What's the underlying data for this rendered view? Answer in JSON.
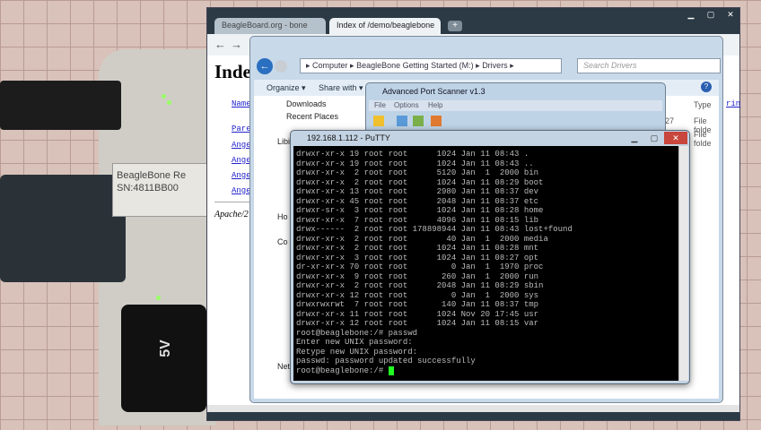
{
  "photo": {
    "board_label": "BeagleBone Re",
    "serial": "SN:4811BB00",
    "power_label": "5V"
  },
  "browser": {
    "tabs": [
      {
        "label": "BeagleBoard.org - bone"
      },
      {
        "label": "Index of /demo/beaglebone"
      }
    ],
    "new_tab": "+",
    "heading": "Inde",
    "name_header": "Name",
    "links": [
      "Pare",
      "Ange",
      "Ange",
      "Ange",
      "Ange"
    ],
    "footer": "Apache/2",
    "right_link": "rin"
  },
  "explorer": {
    "breadcrumb": [
      "Computer",
      "BeagleBone Getting Started (M:)",
      "Drivers"
    ],
    "search_placeholder": "Search Drivers",
    "commands": [
      "Organize ▾",
      "Share with ▾"
    ],
    "nav": [
      "Downloads",
      "Recent Places",
      "Libi",
      "Ho",
      "Co",
      "Net"
    ],
    "type_header": "Type",
    "rows": [
      {
        "date": "27",
        "type": "File folde"
      },
      {
        "date": "",
        "type": "File folde"
      }
    ]
  },
  "scanner": {
    "title": "Advanced Port Scanner v1.3",
    "menu": [
      "File",
      "Options",
      "Help"
    ]
  },
  "putty": {
    "title": "192.168.1.112 - PuTTY",
    "lines": [
      "drwxr-xr-x 19 root root      1024 Jan 11 08:43 .",
      "drwxr-xr-x 19 root root      1024 Jan 11 08:43 ..",
      "drwxr-xr-x  2 root root      5120 Jan  1  2000 bin",
      "drwxr-xr-x  2 root root      1024 Jan 11 08:29 boot",
      "drwxr-xr-x 13 root root      2980 Jan 11 08:37 dev",
      "drwxr-xr-x 45 root root      2048 Jan 11 08:37 etc",
      "drwxr-sr-x  3 root root      1024 Jan 11 08:28 home",
      "drwxr-xr-x  7 root root      4096 Jan 11 08:15 lib",
      "drwx------  2 root root 178898944 Jan 11 08:43 lost+found",
      "drwxr-xr-x  2 root root        40 Jan  1  2000 media",
      "drwxr-xr-x  2 root root      1024 Jan 11 08:28 mnt",
      "drwxr-xr-x  3 root root      1024 Jan 11 08:27 opt",
      "dr-xr-xr-x 70 root root         0 Jan  1  1970 proc",
      "drwxr-xr-x  9 root root       260 Jan  1  2000 run",
      "drwxr-xr-x  2 root root      2048 Jan 11 08:29 sbin",
      "drwxr-xr-x 12 root root         0 Jan  1  2000 sys",
      "drwxrwxrwt  7 root root       140 Jan 11 08:37 tmp",
      "drwxr-xr-x 11 root root      1024 Nov 20 17:45 usr",
      "drwxr-xr-x 12 root root      1024 Jan 11 08:15 var",
      "root@beaglebone:/# passwd",
      "Enter new UNIX password:",
      "Retype new UNIX password:",
      "passwd: password updated successfully"
    ],
    "prompt": "root@beaglebone:/# "
  }
}
